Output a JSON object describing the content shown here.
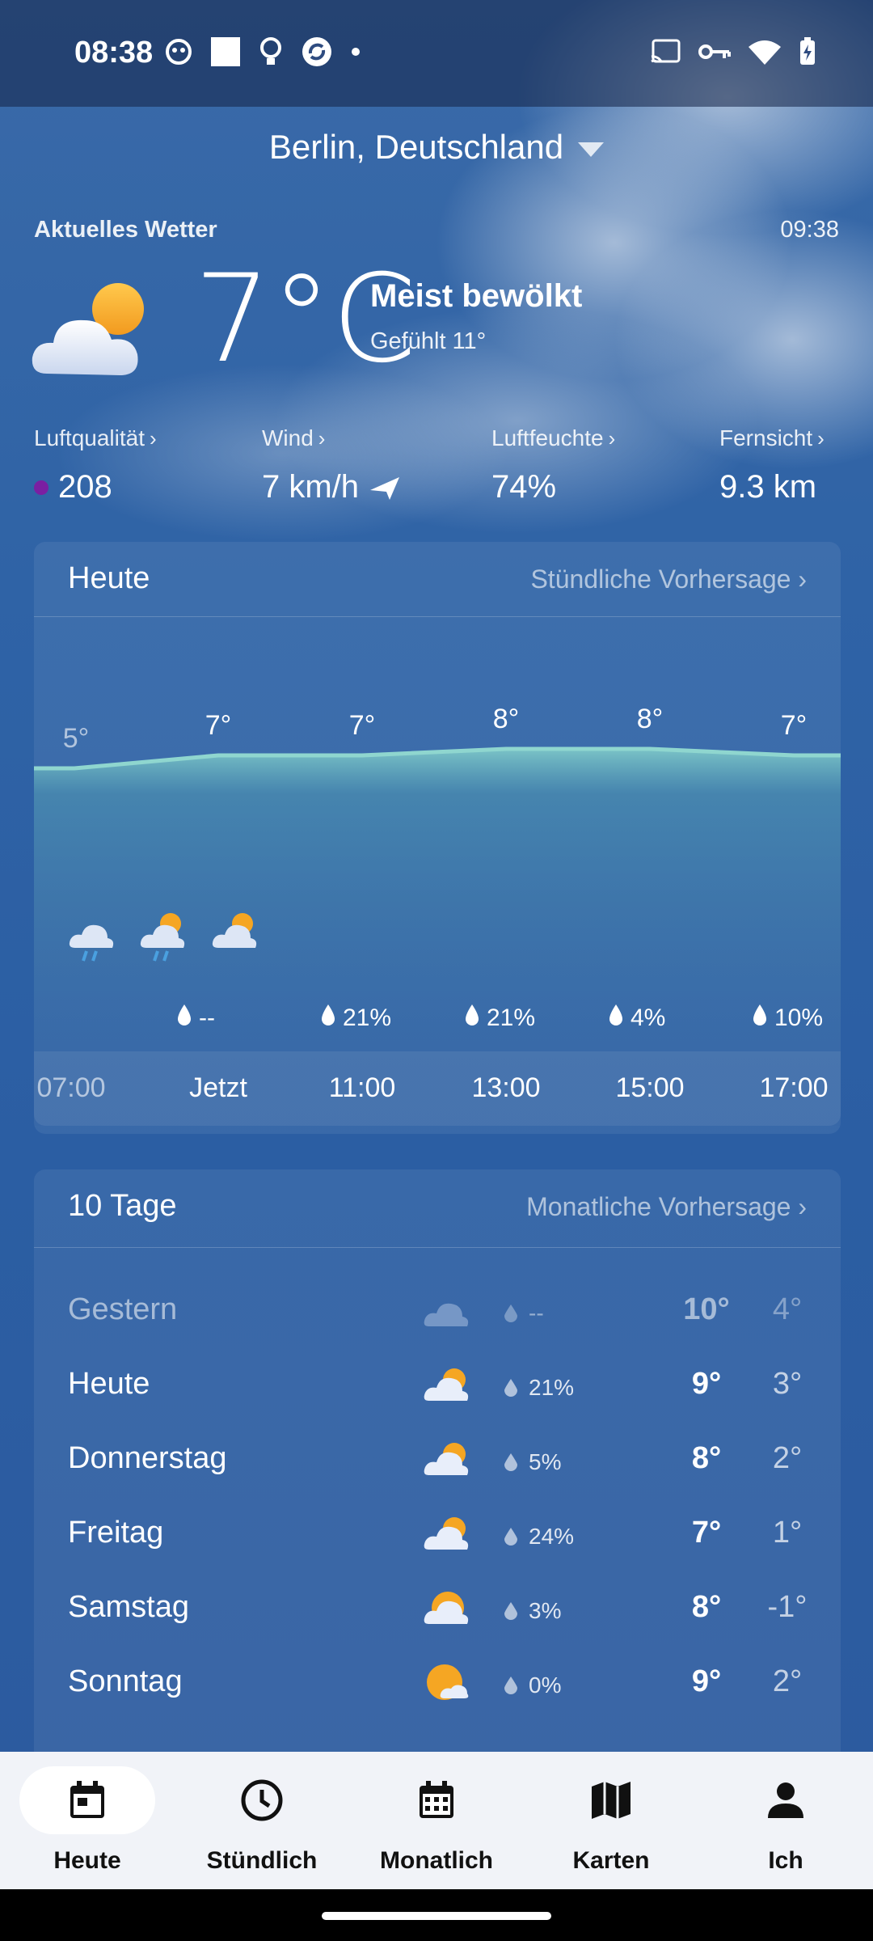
{
  "status_bar": {
    "time": "08:38"
  },
  "location": {
    "name": "Berlin, Deutschland"
  },
  "current": {
    "label": "Aktuelles Wetter",
    "updated": "09:38",
    "temperature": "7°C",
    "condition": "Meist bewölkt",
    "feels_like": "Gefühlt 11°",
    "metrics": [
      {
        "label": "Luftqualität",
        "value": "208",
        "aqi_color": "#7b1fa2"
      },
      {
        "label": "Wind",
        "value": "7 km/h"
      },
      {
        "label": "Luftfeuchte",
        "value": "74%"
      },
      {
        "label": "Fernsicht",
        "value": "9.3 km"
      }
    ]
  },
  "today": {
    "title": "Heute",
    "link": "Stündliche Vorhersage",
    "hours": [
      {
        "time": "07:00",
        "temp": "5°",
        "rain": "",
        "icon": "rain-cloud-icon"
      },
      {
        "time": "Jetzt",
        "temp": "7°",
        "rain": "--",
        "icon": "partly-cloudy-icon"
      },
      {
        "time": "11:00",
        "temp": "7°",
        "rain": "21%",
        "icon": ""
      },
      {
        "time": "13:00",
        "temp": "8°",
        "rain": "21%",
        "icon": ""
      },
      {
        "time": "15:00",
        "temp": "8°",
        "rain": "4%",
        "icon": ""
      },
      {
        "time": "17:00",
        "temp": "7°",
        "rain": "10%",
        "icon": ""
      }
    ],
    "chart_data": {
      "type": "area",
      "x": [
        "07:00",
        "Jetzt",
        "11:00",
        "13:00",
        "15:00",
        "17:00"
      ],
      "series": [
        {
          "values": [
            5,
            7,
            7,
            8,
            8,
            7
          ]
        }
      ]
    }
  },
  "ten_day": {
    "title": "10 Tage",
    "link": "Monatliche Vorhersage",
    "days": [
      {
        "name": "Gestern",
        "rain": "--",
        "high": "10°",
        "low": "4°",
        "icon": "cloud-icon",
        "past": true
      },
      {
        "name": "Heute",
        "rain": "21%",
        "high": "9°",
        "low": "3°",
        "icon": "partly-cloudy-icon",
        "past": false
      },
      {
        "name": "Donnerstag",
        "rain": "5%",
        "high": "8°",
        "low": "2°",
        "icon": "partly-cloudy-icon",
        "past": false
      },
      {
        "name": "Freitag",
        "rain": "24%",
        "high": "7°",
        "low": "1°",
        "icon": "partly-cloudy-icon",
        "past": false
      },
      {
        "name": "Samstag",
        "rain": "3%",
        "high": "8°",
        "low": "-1°",
        "icon": "mostly-sunny-icon",
        "past": false
      },
      {
        "name": "Sonntag",
        "rain": "0%",
        "high": "9°",
        "low": "2°",
        "icon": "sunny-cloud-icon",
        "past": false
      }
    ]
  },
  "nav": {
    "items": [
      {
        "label": "Heute",
        "icon": "calendar-today-icon",
        "active": true
      },
      {
        "label": "Stündlich",
        "icon": "clock-icon",
        "active": false
      },
      {
        "label": "Monatlich",
        "icon": "calendar-month-icon",
        "active": false
      },
      {
        "label": "Karten",
        "icon": "map-icon",
        "active": false
      },
      {
        "label": "Ich",
        "icon": "person-icon",
        "active": false
      }
    ]
  }
}
